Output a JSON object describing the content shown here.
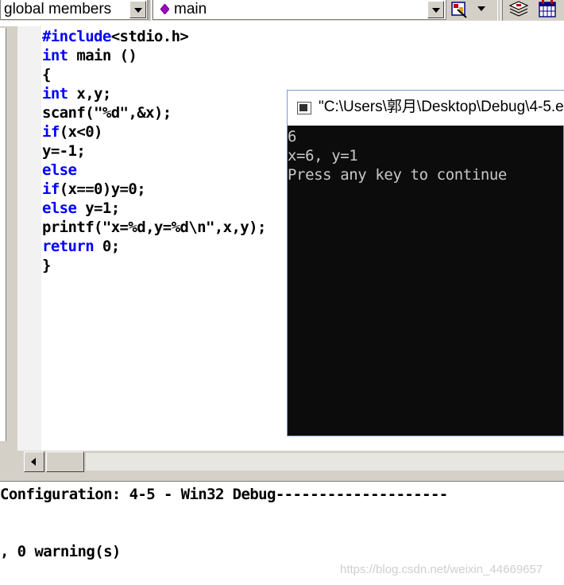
{
  "toolbar": {
    "scope_combo": "global members",
    "function_combo": "main",
    "icons": [
      "diamond-icon",
      "wizard-icon",
      "chevron-down-icon",
      "stack-icon",
      "calendar-icon"
    ],
    "function_icon_color": "#a000c8"
  },
  "editor": {
    "keyword_color": "#0000ff",
    "lines": [
      {
        "kw": "#include",
        "rest": "<stdio.h>"
      },
      {
        "kw": "int",
        "rest": " main ()"
      },
      {
        "kw": "",
        "rest": "{"
      },
      {
        "kw": "int",
        "rest": " x,y;"
      },
      {
        "kw": "",
        "rest": "scanf(\"%d\",&x);"
      },
      {
        "kw": "if",
        "rest": "(x<0)"
      },
      {
        "kw": "",
        "rest": "y=-1;"
      },
      {
        "kw": "else",
        "rest": ""
      },
      {
        "kw": "if",
        "rest": "(x==0)y=0;"
      },
      {
        "kw": "else",
        "rest": " y=1;"
      },
      {
        "kw": "",
        "rest": "printf(\"x=%d,y=%d\\n\",x,y);"
      },
      {
        "kw": "return",
        "rest": " 0;"
      },
      {
        "kw": "",
        "rest": "}"
      }
    ]
  },
  "console": {
    "title": "\"C:\\Users\\郭月\\Desktop\\Debug\\4-5.e",
    "lines": [
      "6",
      "x=6, y=1",
      "Press any key to continue"
    ]
  },
  "output": {
    "config_line": "Configuration: 4-5 - Win32 Debug--------------------",
    "warning_line": ", 0 warning(s)"
  },
  "watermark": "https://blog.csdn.net/weixin_44669657"
}
